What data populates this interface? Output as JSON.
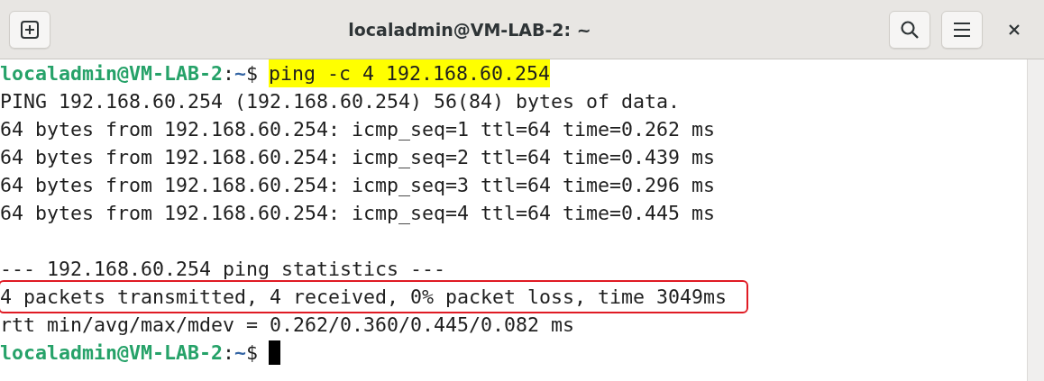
{
  "window": {
    "title": "localadmin@VM-LAB-2: ~"
  },
  "terminal": {
    "lines": [
      {
        "kind": "prompt",
        "user_host": "localadmin@VM-LAB-2",
        "separator": ":",
        "path": "~",
        "symbol": "$",
        "command": "ping -c 4 192.168.60.254",
        "highlighted": true
      },
      {
        "kind": "output",
        "text": "PING 192.168.60.254 (192.168.60.254) 56(84) bytes of data.",
        "boxed": false
      },
      {
        "kind": "output",
        "text": "64 bytes from 192.168.60.254: icmp_seq=1 ttl=64 time=0.262 ms",
        "boxed": false
      },
      {
        "kind": "output",
        "text": "64 bytes from 192.168.60.254: icmp_seq=2 ttl=64 time=0.439 ms",
        "boxed": false
      },
      {
        "kind": "output",
        "text": "64 bytes from 192.168.60.254: icmp_seq=3 ttl=64 time=0.296 ms",
        "boxed": false
      },
      {
        "kind": "output",
        "text": "64 bytes from 192.168.60.254: icmp_seq=4 ttl=64 time=0.445 ms",
        "boxed": false
      },
      {
        "kind": "blank"
      },
      {
        "kind": "output",
        "text": "--- 192.168.60.254 ping statistics ---",
        "boxed": false
      },
      {
        "kind": "output",
        "text": "4 packets transmitted, 4 received, 0% packet loss, time 3049ms",
        "boxed": true
      },
      {
        "kind": "output",
        "text": "rtt min/avg/max/mdev = 0.262/0.360/0.445/0.082 ms",
        "boxed": false
      },
      {
        "kind": "prompt",
        "user_host": "localadmin@VM-LAB-2",
        "separator": ":",
        "path": "~",
        "symbol": "$",
        "cursor": true
      }
    ]
  }
}
